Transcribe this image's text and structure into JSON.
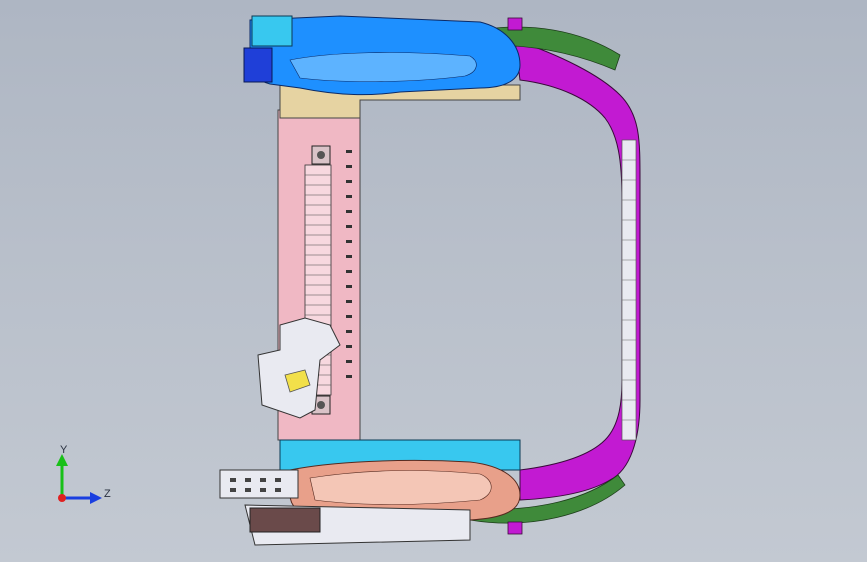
{
  "viewport": {
    "background_top": "#aeb6c3",
    "background_bottom": "#c3c9d2"
  },
  "model": {
    "description_icon": "seat-frame-3d-model",
    "colors": {
      "blue_part": "#1e90ff",
      "dark_blue_part": "#1f3fd8",
      "cyan_part": "#38c8ef",
      "pink_part": "#f0b8c4",
      "magenta_part": "#c21ad2",
      "green_part": "#3f8a3a",
      "tan_part": "#e6d3a2",
      "salmon_part": "#e8a08a",
      "light_part": "#e9eaf1",
      "yellow_part": "#f2e04a",
      "dark_part": "#6a4a4a"
    }
  },
  "triad": {
    "y_label": "Y",
    "z_label": "Z",
    "y_color": "#18c018",
    "z_color": "#1a3fe0",
    "origin_color": "#e02020"
  }
}
